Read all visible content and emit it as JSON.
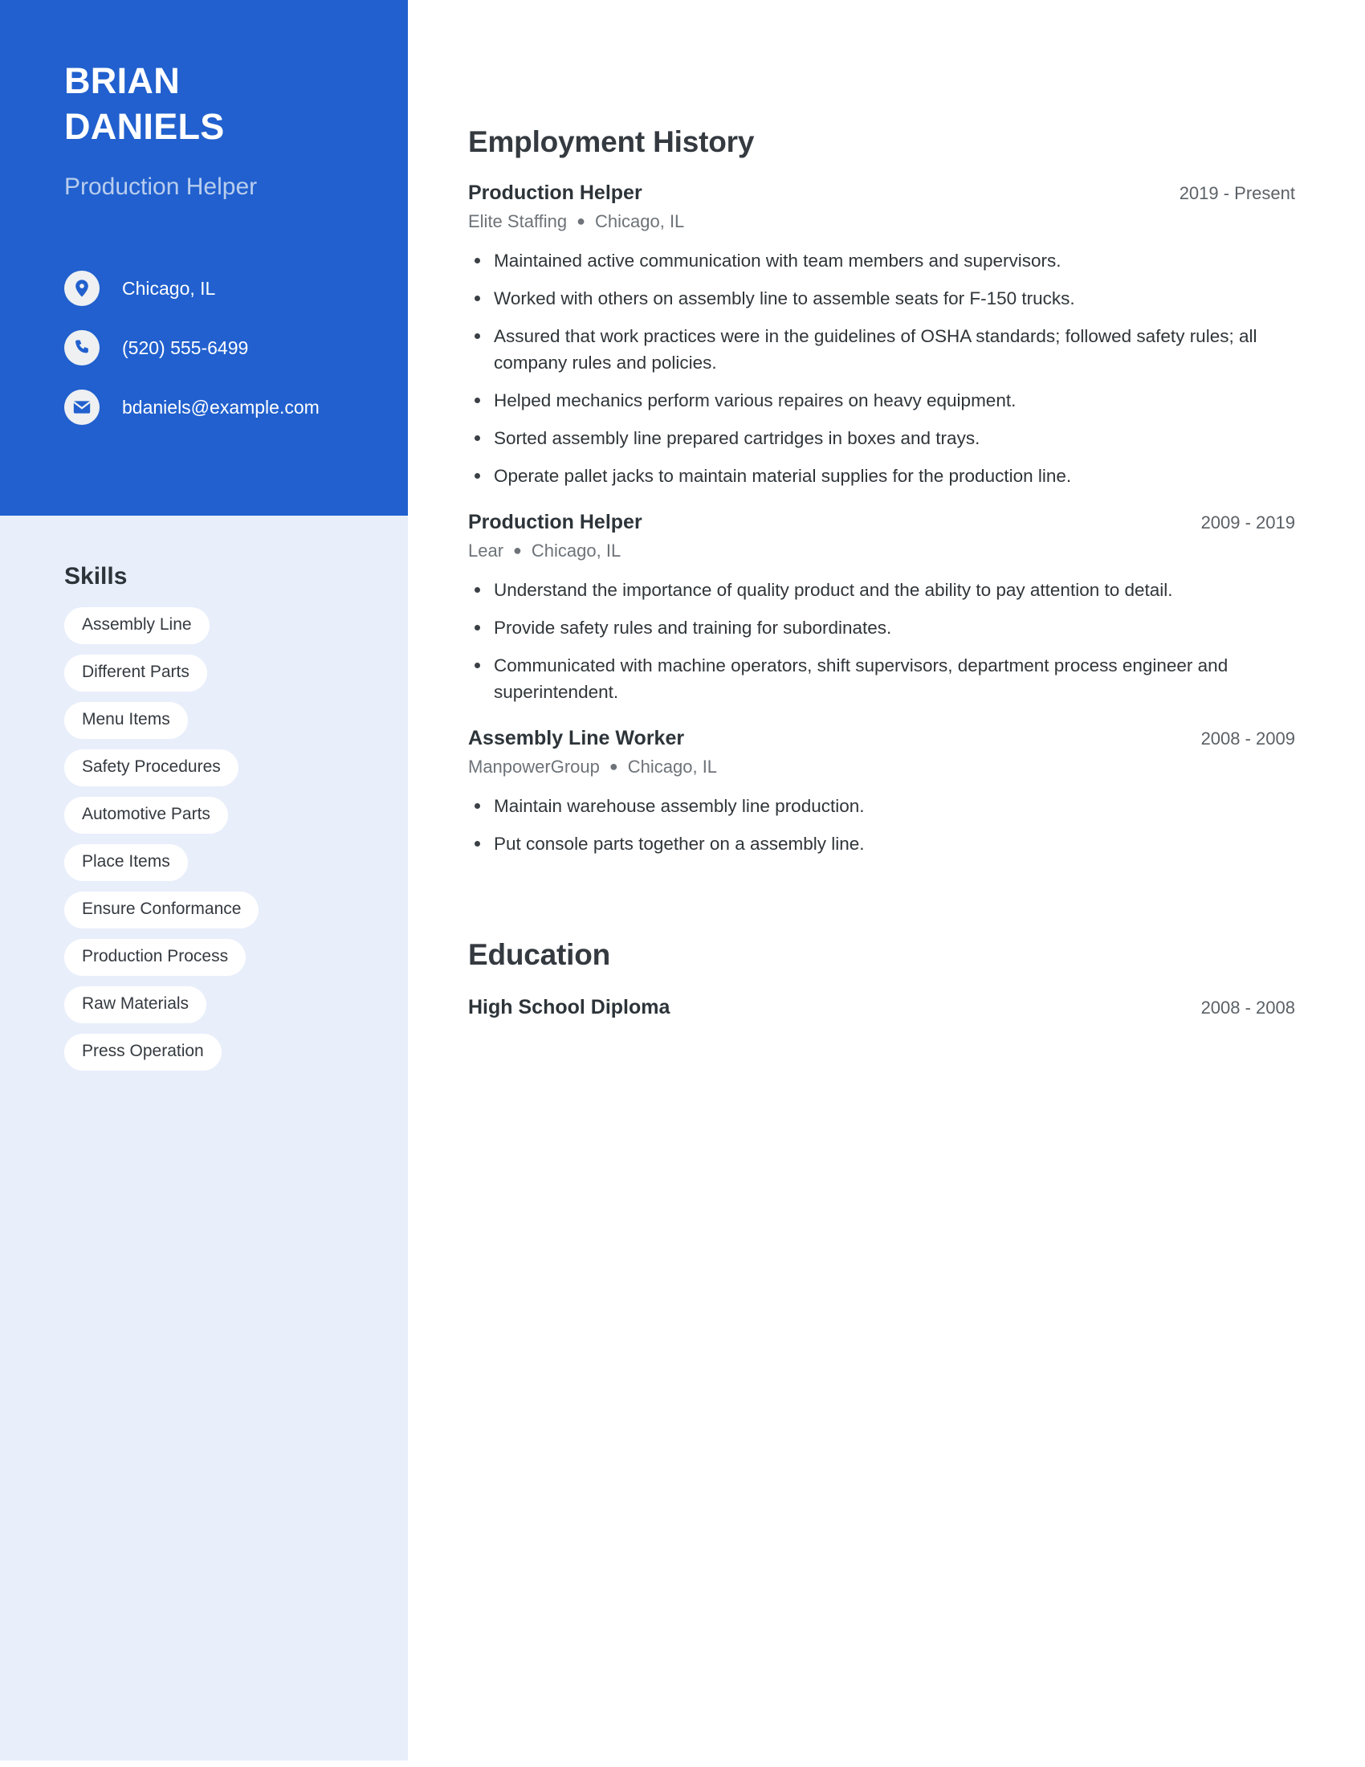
{
  "theme": {
    "primary": "#2160ce",
    "sidebar_light": "#e8eefa",
    "pill_bg": "#ffffff",
    "heading_color": "#343a40",
    "muted_text": "#6d7378",
    "job_title_color": "#b9cdee"
  },
  "sidebar": {
    "first_name": "BRIAN",
    "last_name": "DANIELS",
    "job_title": "Production Helper",
    "contacts": [
      {
        "icon": "location-pin-icon",
        "value": "Chicago, IL"
      },
      {
        "icon": "phone-icon",
        "value": "(520) 555-6499"
      },
      {
        "icon": "envelope-icon",
        "value": "bdaniels@example.com"
      }
    ],
    "skills_heading": "Skills",
    "skills": [
      "Assembly Line",
      "Different Parts",
      "Menu Items",
      "Safety Procedures",
      "Automotive Parts",
      "Place Items",
      "Ensure Conformance",
      "Production Process",
      "Raw Materials",
      "Press Operation"
    ]
  },
  "main": {
    "employment": {
      "heading": "Employment History",
      "entries": [
        {
          "title": "Production Helper",
          "date": "2019 - Present",
          "company": "Elite Staffing",
          "separator": "●",
          "location": "Chicago, IL",
          "bullets": [
            "Maintained active communication with team members and supervisors.",
            "Worked with others on assembly line to assemble seats for F-150 trucks.",
            "Assured that work practices were in the guidelines of OSHA standards; followed safety rules; all company rules and policies.",
            "Helped mechanics perform various repaires on heavy equipment.",
            "Sorted assembly line prepared cartridges in boxes and trays.",
            "Operate pallet jacks to maintain material supplies for the production line."
          ]
        },
        {
          "title": "Production Helper",
          "date": "2009 - 2019",
          "company": "Lear",
          "separator": "●",
          "location": "Chicago, IL",
          "bullets": [
            "Understand the importance of quality product and the ability to pay attention to detail.",
            "Provide safety rules and training for subordinates.",
            "Communicated with machine operators, shift supervisors, department process engineer and superintendent."
          ]
        },
        {
          "title": "Assembly Line Worker",
          "date": "2008 - 2009",
          "company": "ManpowerGroup",
          "separator": "●",
          "location": "Chicago, IL",
          "bullets": [
            "Maintain warehouse assembly line production.",
            "Put console parts together on a assembly line."
          ]
        }
      ]
    },
    "education": {
      "heading": "Education",
      "entries": [
        {
          "title": "High School Diploma",
          "date": "2008 - 2008"
        }
      ]
    }
  }
}
